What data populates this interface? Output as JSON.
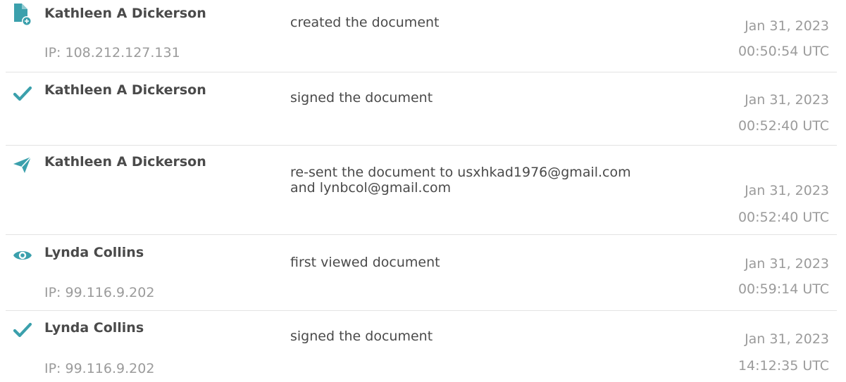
{
  "colors": {
    "accent": "#3ba0ac",
    "name_text": "#4a4a4a",
    "muted_text": "#9b9b9b",
    "divider": "#e3e3e3"
  },
  "events": [
    {
      "icon": "document-add-icon",
      "name": "Kathleen A Dickerson",
      "ip": "IP: 108.212.127.131",
      "action_lines": [
        "created the document"
      ],
      "date": "Jan 31, 2023",
      "time": "00:50:54 UTC"
    },
    {
      "icon": "checkmark-icon",
      "name": "Kathleen A Dickerson",
      "ip": "",
      "action_lines": [
        "signed the document"
      ],
      "date": "Jan 31, 2023",
      "time": "00:52:40 UTC"
    },
    {
      "icon": "paper-plane-icon",
      "name": "Kathleen A Dickerson",
      "ip": "",
      "action_lines": [
        "re-sent the document to usxhkad1976@gmail.com",
        "and lynbcol@gmail.com"
      ],
      "date": "Jan 31, 2023",
      "time": "00:52:40 UTC"
    },
    {
      "icon": "eye-icon",
      "name": "Lynda Collins",
      "ip": "IP: 99.116.9.202",
      "action_lines": [
        "first viewed document"
      ],
      "date": "Jan 31, 2023",
      "time": "00:59:14 UTC"
    },
    {
      "icon": "checkmark-icon",
      "name": "Lynda Collins",
      "ip": "IP: 99.116.9.202",
      "action_lines": [
        "signed the document"
      ],
      "date": "Jan 31, 2023",
      "time": "14:12:35 UTC"
    }
  ]
}
